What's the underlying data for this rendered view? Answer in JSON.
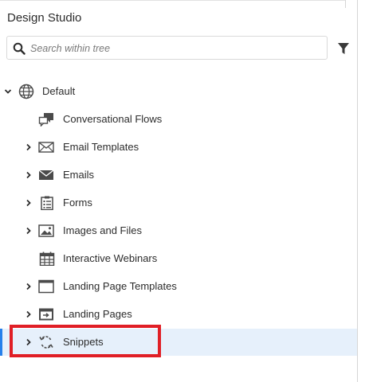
{
  "panel": {
    "title": "Design Studio"
  },
  "search": {
    "placeholder": "Search within tree",
    "icon": "magnifier-icon"
  },
  "filter": {
    "icon": "filter-icon"
  },
  "tree": {
    "root": {
      "label": "Default",
      "icon": "globe-icon",
      "expanded": true
    },
    "items": [
      {
        "label": "Conversational Flows",
        "icon": "chat-bubbles-icon",
        "expandable": false
      },
      {
        "label": "Email Templates",
        "icon": "envelope-outline-icon",
        "expandable": true
      },
      {
        "label": "Emails",
        "icon": "envelope-filled-icon",
        "expandable": true
      },
      {
        "label": "Forms",
        "icon": "clipboard-form-icon",
        "expandable": true
      },
      {
        "label": "Images and Files",
        "icon": "image-icon",
        "expandable": true
      },
      {
        "label": "Interactive Webinars",
        "icon": "calendar-grid-icon",
        "expandable": false
      },
      {
        "label": "Landing Page Templates",
        "icon": "window-icon",
        "expandable": true
      },
      {
        "label": "Landing Pages",
        "icon": "landing-page-icon",
        "expandable": true
      },
      {
        "label": "Snippets",
        "icon": "snippet-cycle-icon",
        "expandable": true,
        "selected": true
      }
    ]
  },
  "colors": {
    "accent": "#2680eb",
    "selected_bg": "#e6f0fb",
    "highlight": "#e01f26",
    "icon": "#4b4b4b"
  }
}
